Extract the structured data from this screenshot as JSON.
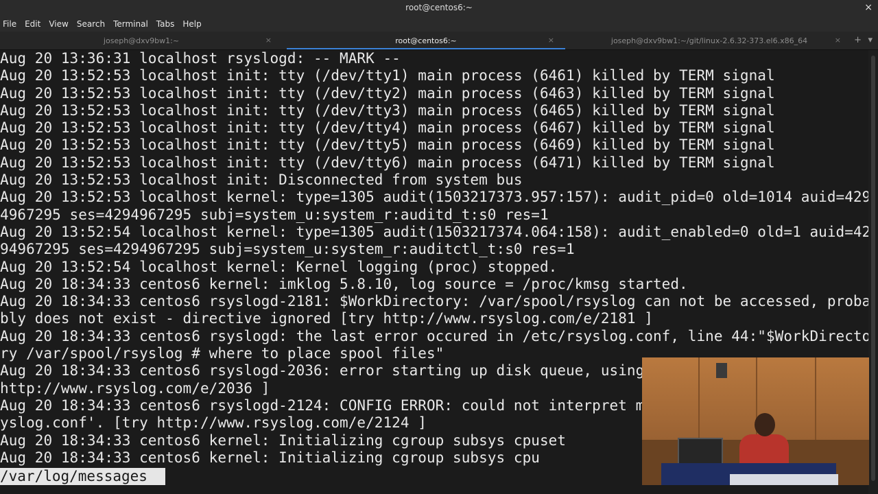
{
  "window": {
    "title": "root@centos6:~"
  },
  "menubar": {
    "items": [
      "File",
      "Edit",
      "View",
      "Search",
      "Terminal",
      "Tabs",
      "Help"
    ]
  },
  "tabs": [
    {
      "label": "joseph@dxv9bw1:~",
      "active": false
    },
    {
      "label": "root@centos6:~",
      "active": true
    },
    {
      "label": "joseph@dxv9bw1:~/git/linux-2.6.32-373.el6.x86_64",
      "active": false
    }
  ],
  "terminal": {
    "lines": [
      "Aug 20 13:36:31 localhost rsyslogd: -- MARK --",
      "Aug 20 13:52:53 localhost init: tty (/dev/tty1) main process (6461) killed by TERM signal",
      "Aug 20 13:52:53 localhost init: tty (/dev/tty2) main process (6463) killed by TERM signal",
      "Aug 20 13:52:53 localhost init: tty (/dev/tty3) main process (6465) killed by TERM signal",
      "Aug 20 13:52:53 localhost init: tty (/dev/tty4) main process (6467) killed by TERM signal",
      "Aug 20 13:52:53 localhost init: tty (/dev/tty5) main process (6469) killed by TERM signal",
      "Aug 20 13:52:53 localhost init: tty (/dev/tty6) main process (6471) killed by TERM signal",
      "Aug 20 13:52:53 localhost init: Disconnected from system bus",
      "Aug 20 13:52:53 localhost kernel: type=1305 audit(1503217373.957:157): audit_pid=0 old=1014 auid=429",
      "4967295 ses=4294967295 subj=system_u:system_r:auditd_t:s0 res=1",
      "Aug 20 13:52:54 localhost kernel: type=1305 audit(1503217374.064:158): audit_enabled=0 old=1 auid=42",
      "94967295 ses=4294967295 subj=system_u:system_r:auditctl_t:s0 res=1",
      "Aug 20 13:52:54 localhost kernel: Kernel logging (proc) stopped.",
      "Aug 20 18:34:33 centos6 kernel: imklog 5.8.10, log source = /proc/kmsg started.",
      "Aug 20 18:34:33 centos6 rsyslogd-2181: $WorkDirectory: /var/spool/rsyslog can not be accessed, proba",
      "bly does not exist - directive ignored [try http://www.rsyslog.com/e/2181 ]",
      "Aug 20 18:34:33 centos6 rsyslogd: the last error occured in /etc/rsyslog.conf, line 44:\"$WorkDirecto",
      "ry /var/spool/rsyslog # where to place spool files\"",
      "Aug 20 18:34:33 centos6 rsyslogd-2036: error starting up disk queue, using",
      "http://www.rsyslog.com/e/2036 ]",
      "Aug 20 18:34:33 centos6 rsyslogd-2124: CONFIG ERROR: could not interpret m",
      "yslog.conf'. [try http://www.rsyslog.com/e/2124 ]",
      "Aug 20 18:34:33 centos6 kernel: Initializing cgroup subsys cpuset",
      "Aug 20 18:34:33 centos6 kernel: Initializing cgroup subsys cpu"
    ],
    "status": "/var/log/messages"
  },
  "icons": {
    "close": "close-icon",
    "tab_close": "tab-close-icon",
    "new_tab": "plus-icon",
    "tab_menu": "chevron-down-icon"
  },
  "colors": {
    "background": "#1b1b1b",
    "text": "#e8e8e8",
    "active_tab_indicator": "#3b82d8",
    "status_bg": "#e6e6e6"
  }
}
